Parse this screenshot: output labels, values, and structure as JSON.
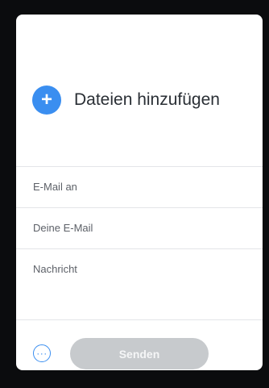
{
  "upload": {
    "add_icon_glyph": "+",
    "label": "Dateien hinzufügen"
  },
  "fields": {
    "recipient_label": "E-Mail an",
    "sender_label": "Deine E-Mail",
    "message_label": "Nachricht"
  },
  "footer": {
    "more_icon_glyph": "···",
    "send_label": "Senden"
  },
  "colors": {
    "accent": "#3a8ef0",
    "disabled_button": "#c7cacd"
  }
}
